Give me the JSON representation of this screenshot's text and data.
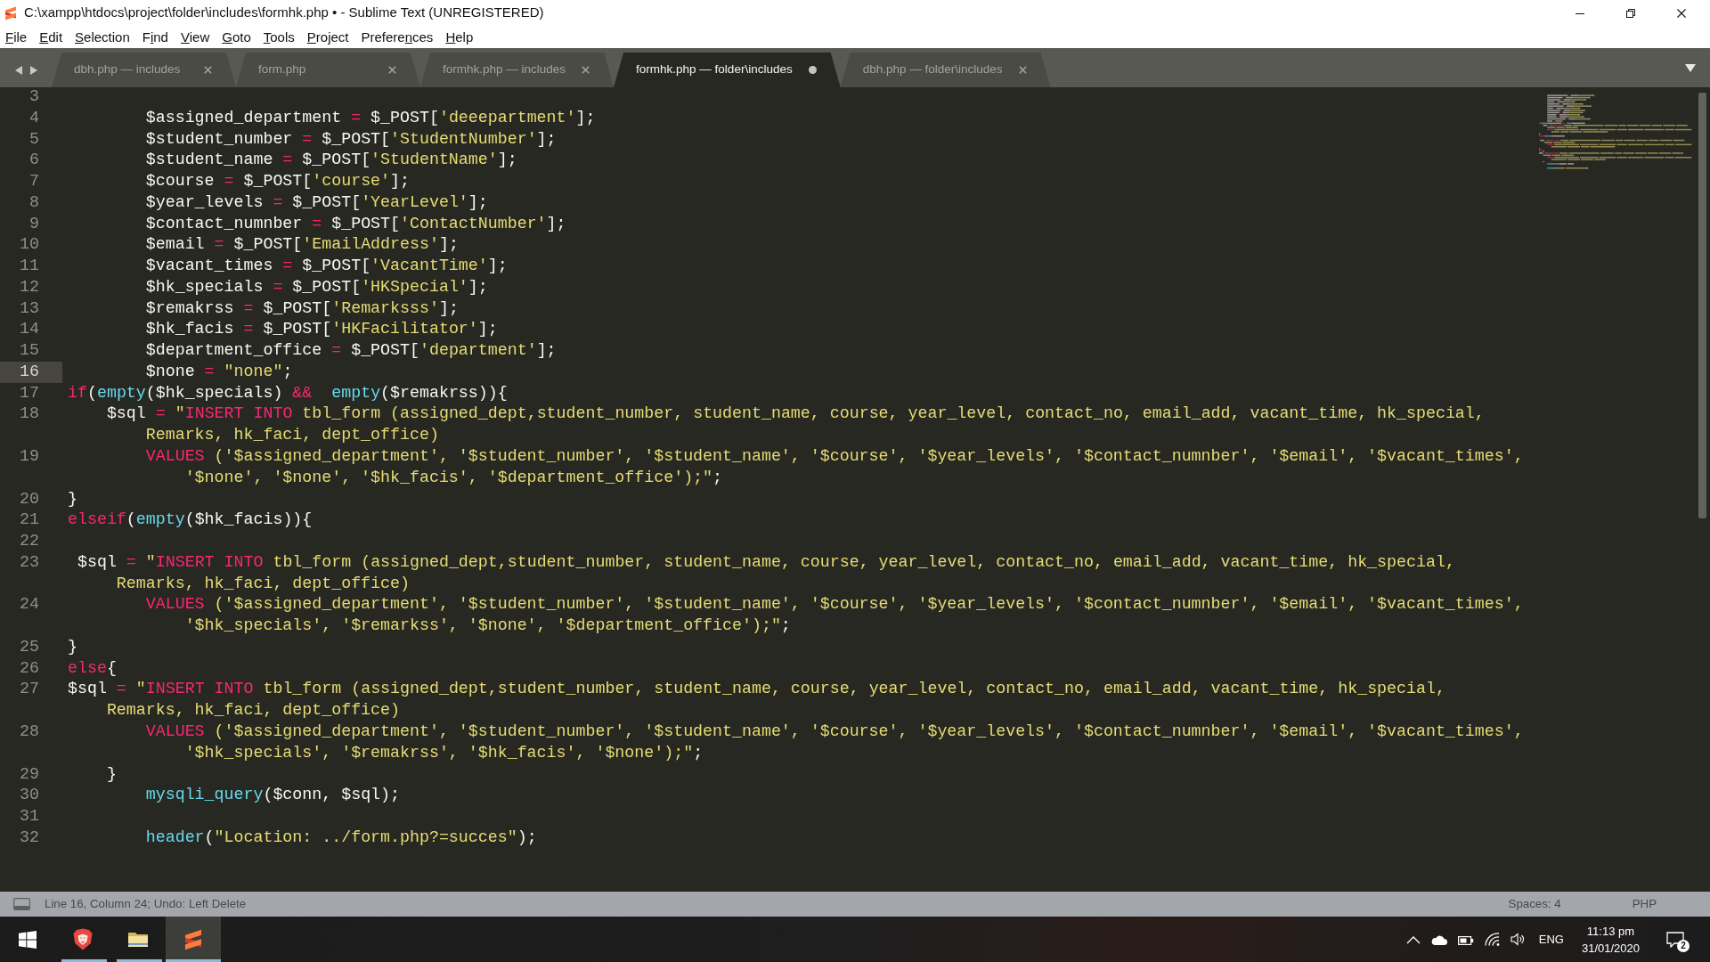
{
  "window": {
    "title": "C:\\xampp\\htdocs\\project\\folder\\includes\\formhk.php • - Sublime Text (UNREGISTERED)"
  },
  "menu": [
    {
      "mnemonic": "F",
      "after": "ile"
    },
    {
      "mnemonic": "E",
      "after": "dit"
    },
    {
      "mnemonic": "S",
      "after": "election"
    },
    {
      "before": "F",
      "mnemonic": "i",
      "after": "nd"
    },
    {
      "mnemonic": "V",
      "after": "iew"
    },
    {
      "mnemonic": "G",
      "after": "oto"
    },
    {
      "mnemonic": "T",
      "after": "ools"
    },
    {
      "mnemonic": "P",
      "after": "roject"
    },
    {
      "before": "Prefere",
      "mnemonic": "n",
      "after": "ces"
    },
    {
      "mnemonic": "H",
      "after": "elp"
    }
  ],
  "tabs": [
    {
      "label": "dbh.php — includes",
      "selected": false,
      "modified": false
    },
    {
      "label": "form.php",
      "selected": false,
      "modified": false
    },
    {
      "label": "formhk.php — includes",
      "selected": false,
      "modified": false
    },
    {
      "label": "formhk.php — folder\\includes",
      "selected": true,
      "modified": true
    },
    {
      "label": "dbh.php — folder\\includes",
      "selected": false,
      "modified": false
    }
  ],
  "editor": {
    "lines": [
      {
        "number": "3",
        "current": false
      },
      {
        "number": "4",
        "current": false,
        "rows": [
          {
            "tokens": [
              {
                "kind": "plain",
                "text": "        $assigned_department "
              },
              {
                "kind": "keyword",
                "text": "="
              },
              {
                "kind": "plain",
                "text": " $_POST["
              },
              {
                "kind": "string",
                "text": "'deeepartment'"
              },
              {
                "kind": "plain",
                "text": "];"
              }
            ]
          }
        ]
      },
      {
        "number": "5",
        "current": false,
        "rows": [
          {
            "tokens": [
              {
                "kind": "plain",
                "text": "        $student_number "
              },
              {
                "kind": "keyword",
                "text": "="
              },
              {
                "kind": "plain",
                "text": " $_POST["
              },
              {
                "kind": "string",
                "text": "'StudentNumber'"
              },
              {
                "kind": "plain",
                "text": "];"
              }
            ]
          }
        ]
      },
      {
        "number": "6",
        "current": false,
        "rows": [
          {
            "tokens": [
              {
                "kind": "plain",
                "text": "        $student_name "
              },
              {
                "kind": "keyword",
                "text": "="
              },
              {
                "kind": "plain",
                "text": " $_POST["
              },
              {
                "kind": "string",
                "text": "'StudentName'"
              },
              {
                "kind": "plain",
                "text": "];"
              }
            ]
          }
        ]
      },
      {
        "number": "7",
        "current": false,
        "rows": [
          {
            "tokens": [
              {
                "kind": "plain",
                "text": "        $course "
              },
              {
                "kind": "keyword",
                "text": "="
              },
              {
                "kind": "plain",
                "text": " $_POST["
              },
              {
                "kind": "string",
                "text": "'course'"
              },
              {
                "kind": "plain",
                "text": "];"
              }
            ]
          }
        ]
      },
      {
        "number": "8",
        "current": false,
        "rows": [
          {
            "tokens": [
              {
                "kind": "plain",
                "text": "        $year_levels "
              },
              {
                "kind": "keyword",
                "text": "="
              },
              {
                "kind": "plain",
                "text": " $_POST["
              },
              {
                "kind": "string",
                "text": "'YearLevel'"
              },
              {
                "kind": "plain",
                "text": "];"
              }
            ]
          }
        ]
      },
      {
        "number": "9",
        "current": false,
        "rows": [
          {
            "tokens": [
              {
                "kind": "plain",
                "text": "        $contact_numnber "
              },
              {
                "kind": "keyword",
                "text": "="
              },
              {
                "kind": "plain",
                "text": " $_POST["
              },
              {
                "kind": "string",
                "text": "'ContactNumber'"
              },
              {
                "kind": "plain",
                "text": "];"
              }
            ]
          }
        ]
      },
      {
        "number": "10",
        "current": false,
        "rows": [
          {
            "tokens": [
              {
                "kind": "plain",
                "text": "        $email "
              },
              {
                "kind": "keyword",
                "text": "="
              },
              {
                "kind": "plain",
                "text": " $_POST["
              },
              {
                "kind": "string",
                "text": "'EmailAddress'"
              },
              {
                "kind": "plain",
                "text": "];"
              }
            ]
          }
        ]
      },
      {
        "number": "11",
        "current": false,
        "rows": [
          {
            "tokens": [
              {
                "kind": "plain",
                "text": "        $vacant_times "
              },
              {
                "kind": "keyword",
                "text": "="
              },
              {
                "kind": "plain",
                "text": " $_POST["
              },
              {
                "kind": "string",
                "text": "'VacantTime'"
              },
              {
                "kind": "plain",
                "text": "];"
              }
            ]
          }
        ]
      },
      {
        "number": "12",
        "current": false,
        "rows": [
          {
            "tokens": [
              {
                "kind": "plain",
                "text": "        $hk_specials "
              },
              {
                "kind": "keyword",
                "text": "="
              },
              {
                "kind": "plain",
                "text": " $_POST["
              },
              {
                "kind": "string",
                "text": "'HKSpecial'"
              },
              {
                "kind": "plain",
                "text": "];"
              }
            ]
          }
        ]
      },
      {
        "number": "13",
        "current": false,
        "rows": [
          {
            "tokens": [
              {
                "kind": "plain",
                "text": "        $remakrss "
              },
              {
                "kind": "keyword",
                "text": "="
              },
              {
                "kind": "plain",
                "text": " $_POST["
              },
              {
                "kind": "string",
                "text": "'Remarksss'"
              },
              {
                "kind": "plain",
                "text": "];"
              }
            ]
          }
        ]
      },
      {
        "number": "14",
        "current": false,
        "rows": [
          {
            "tokens": [
              {
                "kind": "plain",
                "text": "        $hk_facis "
              },
              {
                "kind": "keyword",
                "text": "="
              },
              {
                "kind": "plain",
                "text": " $_POST["
              },
              {
                "kind": "string",
                "text": "'HKFacilitator'"
              },
              {
                "kind": "plain",
                "text": "];"
              }
            ]
          }
        ]
      },
      {
        "number": "15",
        "current": false,
        "rows": [
          {
            "tokens": [
              {
                "kind": "plain",
                "text": "        $department_office "
              },
              {
                "kind": "keyword",
                "text": "="
              },
              {
                "kind": "plain",
                "text": " $_POST["
              },
              {
                "kind": "string",
                "text": "'department'"
              },
              {
                "kind": "plain",
                "text": "];"
              }
            ]
          }
        ]
      },
      {
        "number": "16",
        "current": true,
        "rows": [
          {
            "tokens": [
              {
                "kind": "plain",
                "text": "        $none "
              },
              {
                "kind": "keyword",
                "text": "="
              },
              {
                "kind": "string",
                "text": " \"none\""
              },
              {
                "kind": "plain",
                "text": ";"
              }
            ]
          }
        ]
      },
      {
        "number": "17",
        "current": false,
        "rows": [
          {
            "tokens": [
              {
                "kind": "keyword",
                "text": "if"
              },
              {
                "kind": "plain",
                "text": "("
              },
              {
                "kind": "function",
                "text": "empty"
              },
              {
                "kind": "plain",
                "text": "($hk_specials) "
              },
              {
                "kind": "keyword",
                "text": "&&"
              },
              {
                "kind": "function",
                "text": "  empty"
              },
              {
                "kind": "plain",
                "text": "($remakrss)){"
              }
            ]
          }
        ]
      },
      {
        "number": "18",
        "current": false,
        "rows": [
          {
            "tokens": [
              {
                "kind": "plain",
                "text": "    $sql "
              },
              {
                "kind": "keyword",
                "text": "="
              },
              {
                "kind": "string",
                "text": " \""
              },
              {
                "kind": "keyword",
                "text": "INSERT INTO"
              },
              {
                "kind": "string",
                "text": " tbl_form (assigned_dept,student_number, student_name, course, year_level, contact_no, email_add, vacant_time, hk_special,"
              }
            ]
          },
          {
            "tokens": [
              {
                "kind": "string",
                "text": "        Remarks, hk_faci, dept_office)"
              }
            ]
          }
        ]
      },
      {
        "number": "19",
        "current": false,
        "rows": [
          {
            "tokens": [
              {
                "kind": "keyword",
                "text": "        VALUES"
              },
              {
                "kind": "string",
                "text": " ('$assigned_department', '$student_number', '$student_name', '$course', '$year_levels', '$contact_numnber', '$email', '$vacant_times',"
              }
            ]
          },
          {
            "tokens": [
              {
                "kind": "string",
                "text": "            '$none', '$none', '$hk_facis', '$department_office');\""
              },
              {
                "kind": "plain",
                "text": ";"
              }
            ]
          }
        ]
      },
      {
        "number": "20",
        "current": false,
        "rows": [
          {
            "tokens": [
              {
                "kind": "plain",
                "text": "}"
              }
            ]
          }
        ]
      },
      {
        "number": "21",
        "current": false,
        "rows": [
          {
            "tokens": [
              {
                "kind": "keyword",
                "text": "elseif"
              },
              {
                "kind": "plain",
                "text": "("
              },
              {
                "kind": "function",
                "text": "empty"
              },
              {
                "kind": "plain",
                "text": "($hk_facis)){"
              }
            ]
          }
        ]
      },
      {
        "number": "22",
        "current": false
      },
      {
        "number": "23",
        "current": false,
        "rows": [
          {
            "tokens": [
              {
                "kind": "plain",
                "text": " $sql "
              },
              {
                "kind": "keyword",
                "text": "="
              },
              {
                "kind": "string",
                "text": " \""
              },
              {
                "kind": "keyword",
                "text": "INSERT INTO"
              },
              {
                "kind": "string",
                "text": " tbl_form (assigned_dept,student_number, student_name, course, year_level, contact_no, email_add, vacant_time, hk_special,"
              }
            ]
          },
          {
            "tokens": [
              {
                "kind": "string",
                "text": "     Remarks, hk_faci, dept_office)"
              }
            ]
          }
        ]
      },
      {
        "number": "24",
        "current": false,
        "rows": [
          {
            "tokens": [
              {
                "kind": "keyword",
                "text": "        VALUES"
              },
              {
                "kind": "string",
                "text": " ('$assigned_department', '$student_number', '$student_name', '$course', '$year_levels', '$contact_numnber', '$email', '$vacant_times',"
              }
            ]
          },
          {
            "tokens": [
              {
                "kind": "string",
                "text": "            '$hk_specials', '$remarkss', '$none', '$department_office');\""
              },
              {
                "kind": "plain",
                "text": ";"
              }
            ]
          }
        ]
      },
      {
        "number": "25",
        "current": false,
        "rows": [
          {
            "tokens": [
              {
                "kind": "plain",
                "text": "}"
              }
            ]
          }
        ]
      },
      {
        "number": "26",
        "current": false,
        "rows": [
          {
            "tokens": [
              {
                "kind": "keyword",
                "text": "else"
              },
              {
                "kind": "plain",
                "text": "{"
              }
            ]
          }
        ]
      },
      {
        "number": "27",
        "current": false,
        "rows": [
          {
            "tokens": [
              {
                "kind": "plain",
                "text": "$sql "
              },
              {
                "kind": "keyword",
                "text": "="
              },
              {
                "kind": "string",
                "text": " \""
              },
              {
                "kind": "keyword",
                "text": "INSERT INTO"
              },
              {
                "kind": "string",
                "text": " tbl_form (assigned_dept,student_number, student_name, course, year_level, contact_no, email_add, vacant_time, hk_special,"
              }
            ]
          },
          {
            "tokens": [
              {
                "kind": "string",
                "text": "    Remarks, hk_faci, dept_office)"
              }
            ]
          }
        ]
      },
      {
        "number": "28",
        "current": false,
        "rows": [
          {
            "tokens": [
              {
                "kind": "keyword",
                "text": "        VALUES"
              },
              {
                "kind": "string",
                "text": " ('$assigned_department', '$student_number', '$student_name', '$course', '$year_levels', '$contact_numnber', '$email', '$vacant_times',"
              }
            ]
          },
          {
            "tokens": [
              {
                "kind": "string",
                "text": "            '$hk_specials', '$remakrss', '$hk_facis', '$none');\""
              },
              {
                "kind": "plain",
                "text": ";"
              }
            ]
          }
        ]
      },
      {
        "number": "29",
        "current": false,
        "rows": [
          {
            "tokens": [
              {
                "kind": "plain",
                "text": "    }"
              }
            ]
          }
        ]
      },
      {
        "number": "30",
        "current": false,
        "rows": [
          {
            "tokens": [
              {
                "kind": "function",
                "text": "        mysqli_query"
              },
              {
                "kind": "plain",
                "text": "($conn, $sql);"
              }
            ]
          }
        ]
      },
      {
        "number": "31",
        "current": false
      },
      {
        "number": "32",
        "current": false,
        "rows": [
          {
            "tokens": [
              {
                "kind": "function",
                "text": "        header"
              },
              {
                "kind": "plain",
                "text": "("
              },
              {
                "kind": "string",
                "text": "\"Location: ../form.php?=succes\""
              },
              {
                "kind": "plain",
                "text": ");"
              }
            ]
          }
        ]
      }
    ]
  },
  "status_bar": {
    "message": "Line 16, Column 24; Undo: Left Delete",
    "indentation": "Spaces: 4",
    "syntax": "PHP"
  },
  "taskbar": {
    "apps": [
      {
        "kind": "browser",
        "running": true,
        "selected": false
      },
      {
        "kind": "folder",
        "running": true,
        "selected": false
      },
      {
        "kind": "editor",
        "running": true,
        "selected": true
      }
    ],
    "language": "ENG",
    "time": "11:13 pm",
    "date": "31/01/2020",
    "notifications": "2"
  }
}
